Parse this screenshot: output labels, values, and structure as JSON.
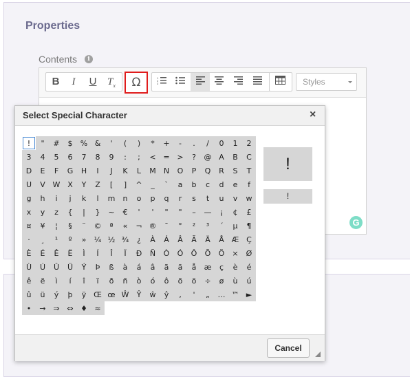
{
  "properties": {
    "title": "Properties"
  },
  "contents": {
    "label": "Contents",
    "info_icon": "i"
  },
  "toolbar": {
    "bold": "B",
    "italic": "I",
    "underline": "U",
    "clear_format": "T",
    "special_char": "Ω",
    "styles_label": "Styles"
  },
  "dialog": {
    "title": "Select Special Character",
    "close": "×",
    "cancel_label": "Cancel",
    "preview_char": "!",
    "preview_small": "!",
    "rows": [
      [
        "!",
        "\"",
        "#",
        "$",
        "%",
        "&",
        "'",
        "(",
        ")",
        "*",
        "+",
        "-",
        ".",
        "/",
        "0",
        "1",
        "2"
      ],
      [
        "3",
        "4",
        "5",
        "6",
        "7",
        "8",
        "9",
        ":",
        ";",
        "<",
        "=",
        ">",
        "?",
        "@",
        "A",
        "B",
        "C"
      ],
      [
        "D",
        "E",
        "F",
        "G",
        "H",
        "I",
        "J",
        "K",
        "L",
        "M",
        "N",
        "O",
        "P",
        "Q",
        "R",
        "S",
        "T"
      ],
      [
        "U",
        "V",
        "W",
        "X",
        "Y",
        "Z",
        "[",
        "]",
        "^",
        "_",
        "`",
        "a",
        "b",
        "c",
        "d",
        "e",
        "f"
      ],
      [
        "g",
        "h",
        "i",
        "j",
        "k",
        "l",
        "m",
        "n",
        "o",
        "p",
        "q",
        "r",
        "s",
        "t",
        "u",
        "v",
        "w"
      ],
      [
        "x",
        "y",
        "z",
        "{",
        "|",
        "}",
        "~",
        "€",
        "'",
        "'",
        "\"",
        "\"",
        "–",
        "—",
        "¡",
        "¢",
        "£"
      ],
      [
        "¤",
        "¥",
        "¦",
        "§",
        "¨",
        "©",
        "ª",
        "«",
        "¬",
        "®",
        "¯",
        "°",
        "²",
        "³",
        "´",
        "µ",
        "¶"
      ],
      [
        "·",
        "¸",
        "¹",
        "º",
        "»",
        "¼",
        "½",
        "¾",
        "¿",
        "À",
        "Á",
        "Â",
        "Ã",
        "Ä",
        "Å",
        "Æ",
        "Ç"
      ],
      [
        "È",
        "É",
        "Ê",
        "Ë",
        "Ì",
        "Í",
        "Î",
        "Ï",
        "Ð",
        "Ñ",
        "Ò",
        "Ó",
        "Ô",
        "Õ",
        "Ö",
        "×",
        "Ø"
      ],
      [
        "Ù",
        "Ú",
        "Û",
        "Ü",
        "Ý",
        "Þ",
        "ß",
        "à",
        "á",
        "â",
        "ã",
        "ä",
        "å",
        "æ",
        "ç",
        "è",
        "é"
      ],
      [
        "ê",
        "ë",
        "ì",
        "í",
        "î",
        "ï",
        "ð",
        "ñ",
        "ò",
        "ó",
        "ô",
        "õ",
        "ö",
        "÷",
        "ø",
        "ù",
        "ú"
      ],
      [
        "û",
        "ü",
        "ý",
        "þ",
        "ÿ",
        "Œ",
        "œ",
        "Ŵ",
        "Ŷ",
        "ŵ",
        "ŷ",
        "‚",
        "'",
        "„",
        "…",
        "™",
        "►"
      ],
      [
        "•",
        "→",
        "⇒",
        "⇔",
        "♦",
        "≈"
      ]
    ]
  }
}
